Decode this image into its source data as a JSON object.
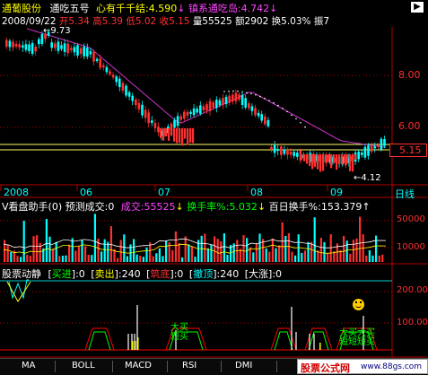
{
  "header": {
    "stock_name": "通葡股份",
    "indicator_name": "通吃五号",
    "label_xinyou": "心有千千结:",
    "val_xinyou": "4.590",
    "label_tongchi": "镇系通吃岛:",
    "val_tongchi": "4.742",
    "date": "2008/09/22",
    "open": "开5.34",
    "high": "高5.39",
    "low": "低5.02",
    "close": "收5.15",
    "volume": "量55525",
    "amount": "额2902",
    "turnover": "换5.03%",
    "amplitude": "振7"
  },
  "price_axis": {
    "ticks": [
      "8.00",
      "6.00"
    ],
    "current_price": "5.15",
    "high_marker": "9.73",
    "low_marker": "4.12"
  },
  "months": [
    "2008",
    "06",
    "07",
    "08",
    "09"
  ],
  "period": "日线",
  "volume_panel": {
    "title": "V看盘助手(0)",
    "predict": "预测成交:0",
    "label_vol": "成交:",
    "val_vol": "55525",
    "label_turn": "换手率%:",
    "val_turn": "5.032",
    "label_100": "百日换手%:",
    "val_100": "153.379",
    "ticks": [
      "50000",
      "10000"
    ]
  },
  "signal_panel": {
    "title": "股票动静",
    "buy_in": "买进",
    "buy_in_val": ":0",
    "sell_out": "卖出",
    "sell_out_val": ":240",
    "bottom": "筑底",
    "bottom_val": ":0",
    "cancel_top": "撤顶",
    "cancel_top_val": ":240",
    "big_rise": "大涨",
    "big_rise_val": ":0",
    "ticks": [
      "200.00",
      "100.00"
    ],
    "annot_big_buy_1": "大买",
    "annot_short_buy_1": "短买",
    "annot_big_buy_2": "大买大买",
    "annot_short_buy_2": "短短短买"
  },
  "tabs": [
    "MA",
    "BOLL",
    "MACD",
    "RSI",
    "DMI"
  ],
  "watermark": {
    "text": "股票公式网",
    "url": "www.88gs.com"
  },
  "colors": {
    "up": "#ff3030",
    "down": "#00ffff",
    "yellow": "#ffff00",
    "magenta": "#cc33cc",
    "grid_red": "#b00000"
  }
}
